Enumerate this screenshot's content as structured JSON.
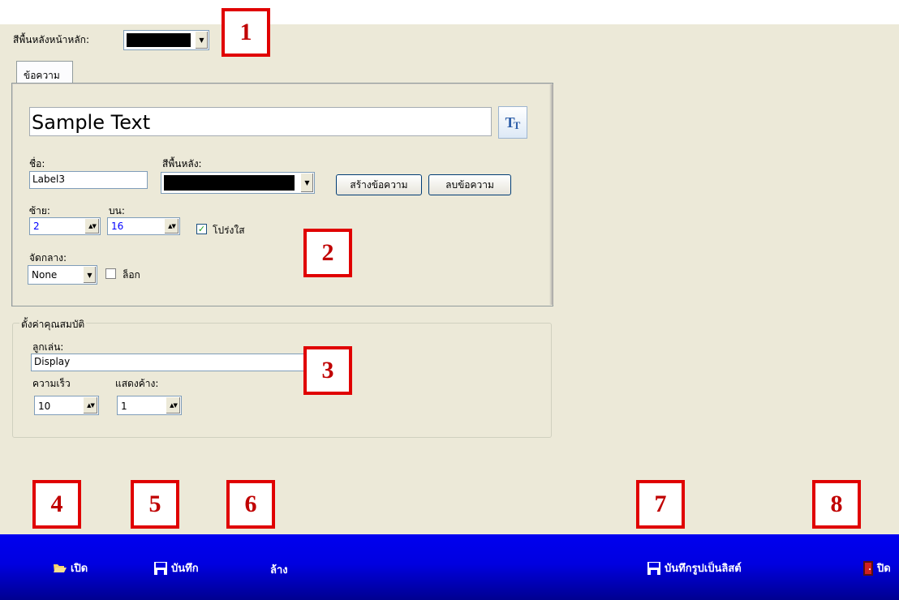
{
  "top": {
    "bg_color_label": "สีพื้นหลังหน้าหลัก:"
  },
  "tab": {
    "label": "ข้อความ"
  },
  "text_panel": {
    "sample_text": "Sample Text",
    "name_label": "ชื่อ:",
    "name_value": "Label3",
    "bg_label": "สีพื้นหลัง:",
    "create_button": "สร้างข้อความ",
    "delete_button": "ลบข้อความ",
    "left_label": "ซ้าย:",
    "left_value": "2",
    "top_label": "บน:",
    "top_value": "16",
    "transparent_label": "โปร่งใส",
    "center_label": "จัดกลาง:",
    "center_value": "None",
    "lock_label": "ล็อก"
  },
  "settings": {
    "title": "ตั้งค่าคุณสมบัติ",
    "player_label": "ลูกเล่น:",
    "player_value": "Display",
    "speed_label": "ความเร็ว",
    "speed_value": "10",
    "hold_label": "แสดงค้าง:",
    "hold_value": "1"
  },
  "callouts": [
    "1",
    "2",
    "3",
    "4",
    "5",
    "6",
    "7",
    "8"
  ],
  "bottombar": {
    "open": "เปิด",
    "save": "บันทึก",
    "clear": "ล้าง",
    "save_list": "บันทึกรูปเป็นลิสต์",
    "close": "ปิด"
  },
  "colors": {
    "window_bg": "#ece9d8",
    "bar_blue": "#0000e0",
    "callout_red": "#e00000"
  },
  "icons": [
    "font-icon",
    "folder-open-icon",
    "floppy-disk-icon",
    "exit-door-icon",
    "chevron-down-icon",
    "spin-arrows-icon",
    "checkmark-icon"
  ]
}
